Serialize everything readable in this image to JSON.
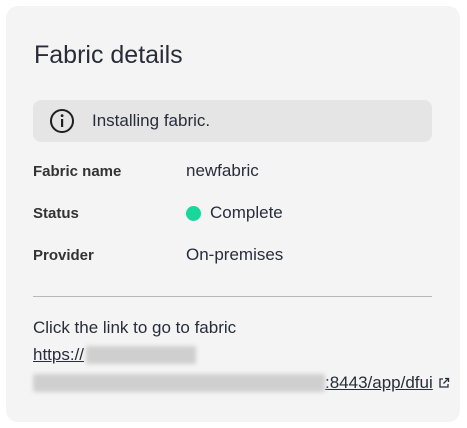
{
  "panel": {
    "title": "Fabric details",
    "notice": "Installing fabric.",
    "fields": {
      "fabric_name": {
        "label": "Fabric name",
        "value": "newfabric"
      },
      "status": {
        "label": "Status",
        "value": "Complete",
        "color": "#17d89a"
      },
      "provider": {
        "label": "Provider",
        "value": "On-premises"
      }
    },
    "link": {
      "intro": "Click the link to go to fabric",
      "line1_prefix": "https://",
      "line2_suffix": ":8443/app/dfui"
    },
    "icons": {
      "info": "info-circle-icon",
      "external": "external-link-icon"
    }
  }
}
